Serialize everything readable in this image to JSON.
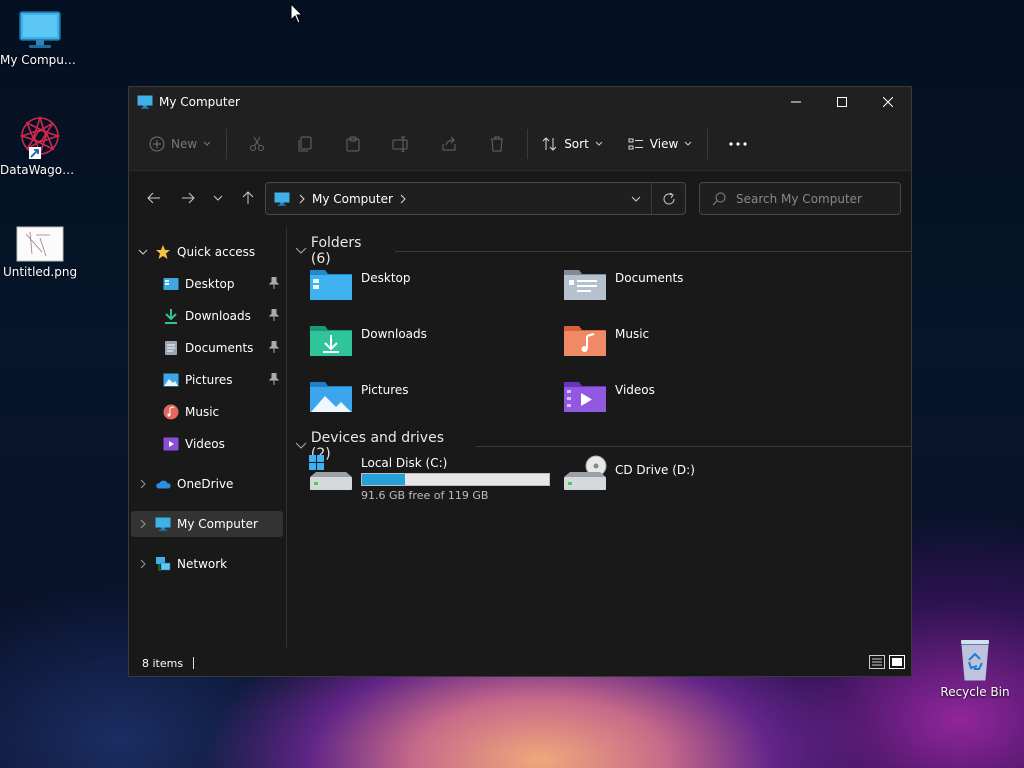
{
  "desktop": {
    "icons": [
      {
        "label": "My Computer"
      },
      {
        "label": "DataWagon..."
      },
      {
        "label": "Untitled.png"
      },
      {
        "label": "Recycle Bin"
      }
    ]
  },
  "window": {
    "title": "My Computer",
    "toolbar": {
      "new_label": "New",
      "sort_label": "Sort",
      "view_label": "View"
    },
    "address": {
      "crumb": "My Computer"
    },
    "search": {
      "placeholder": "Search My Computer"
    },
    "sidebar": {
      "quick_access": "Quick access",
      "items": [
        {
          "label": "Desktop",
          "icon": "desktop-icon",
          "pinned": true
        },
        {
          "label": "Downloads",
          "icon": "download-icon",
          "pinned": true
        },
        {
          "label": "Documents",
          "icon": "documents-icon",
          "pinned": true
        },
        {
          "label": "Pictures",
          "icon": "pictures-icon",
          "pinned": true
        },
        {
          "label": "Music",
          "icon": "music-icon",
          "pinned": false
        },
        {
          "label": "Videos",
          "icon": "videos-icon",
          "pinned": false
        }
      ],
      "onedrive": "OneDrive",
      "my_computer": "My Computer",
      "network": "Network"
    },
    "groups": {
      "folders_header": "Folders (6)",
      "devices_header": "Devices and drives (2)"
    },
    "folders": [
      {
        "label": "Desktop"
      },
      {
        "label": "Documents"
      },
      {
        "label": "Downloads"
      },
      {
        "label": "Music"
      },
      {
        "label": "Pictures"
      },
      {
        "label": "Videos"
      }
    ],
    "drives": [
      {
        "label": "Local Disk (C:)",
        "free_text": "91.6 GB free of 119 GB",
        "used_fraction": 0.23
      },
      {
        "label": "CD Drive (D:)"
      }
    ],
    "status": {
      "items_text": "8 items"
    }
  },
  "colors": {
    "accent": "#26a0da",
    "window_bg": "#191919",
    "chrome_bg": "#202020"
  }
}
